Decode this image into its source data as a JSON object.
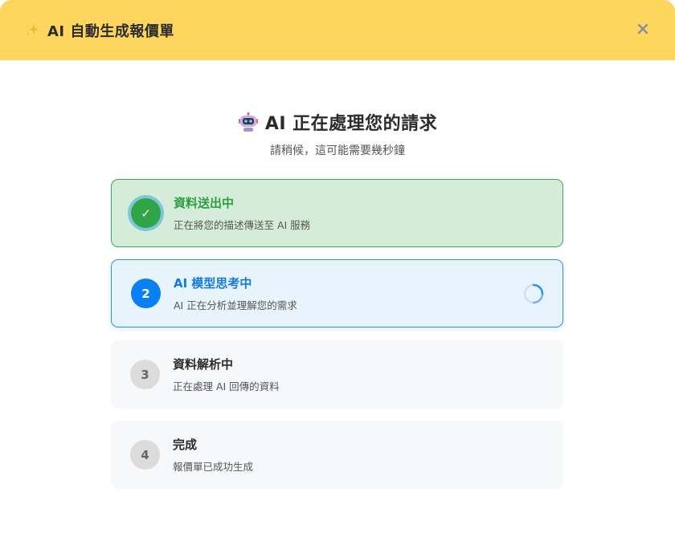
{
  "header": {
    "title": "AI 自動生成報價單",
    "icon": "sparkles-icon",
    "close_icon": "close-icon"
  },
  "status": {
    "title": "AI 正在處理您的請求",
    "subtitle": "請稍候，這可能需要幾秒鐘",
    "icon": "robot-icon"
  },
  "steps": [
    {
      "badge": "✓",
      "title": "資料送出中",
      "description": "正在將您的描述傳送至 AI 服務",
      "state": "done"
    },
    {
      "badge": "2",
      "title": "AI 模型思考中",
      "description": "AI 正在分析並理解您的需求",
      "state": "active"
    },
    {
      "badge": "3",
      "title": "資料解析中",
      "description": "正在處理 AI 回傳的資料",
      "state": "pending"
    },
    {
      "badge": "4",
      "title": "完成",
      "description": "報價單已成功生成",
      "state": "pending"
    }
  ],
  "colors": {
    "header_bg": "#fed65e",
    "done_bg": "#d5edd8",
    "done_border": "#3caa52",
    "active_bg": "#e7f4fc",
    "active_border": "#2f8ff0",
    "pending_bg": "#f7f8fa"
  }
}
